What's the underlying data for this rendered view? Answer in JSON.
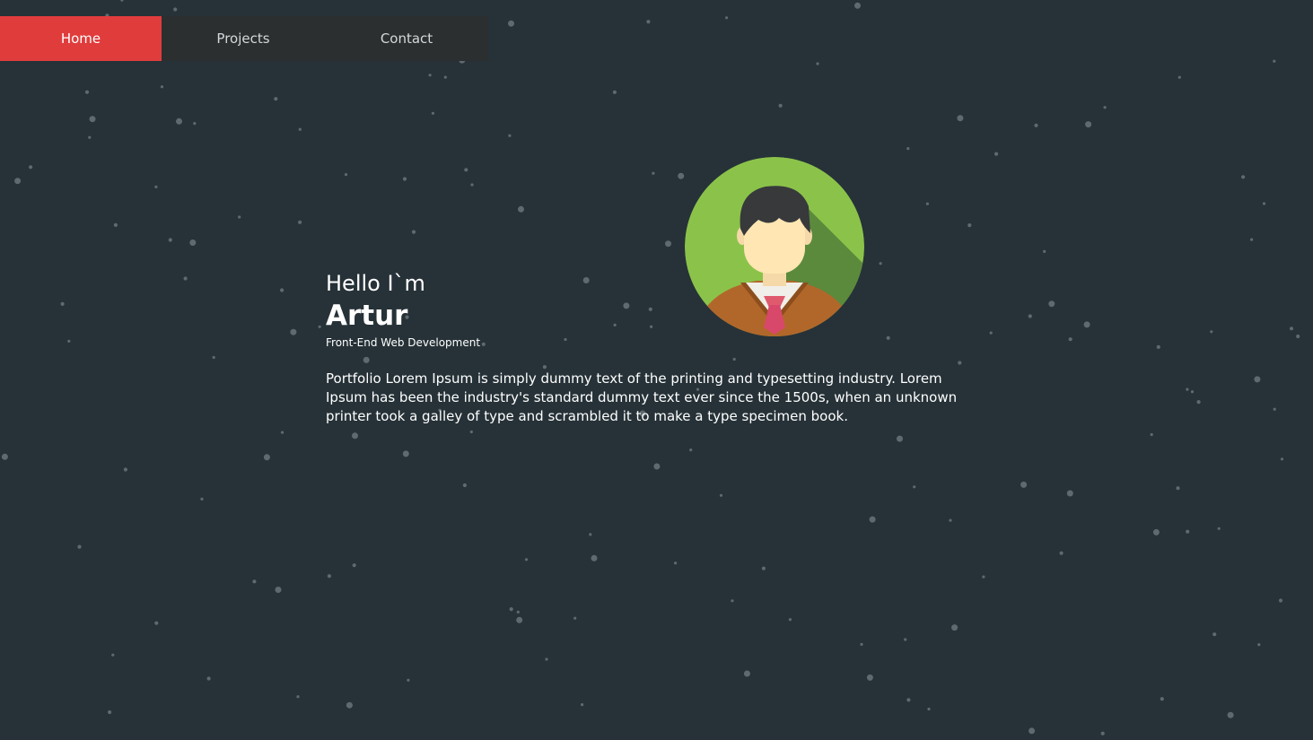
{
  "nav": {
    "items": [
      {
        "label": "Home",
        "active": true
      },
      {
        "label": "Projects",
        "active": false
      },
      {
        "label": "Contact",
        "active": false
      }
    ]
  },
  "hero": {
    "greeting": "Hello I`m",
    "name": "Artur",
    "role": "Front-End Web Development",
    "bio": "Portfolio Lorem Ipsum is simply dummy text of the printing and typesetting industry. Lorem Ipsum has been the industry's standard dummy text ever since the 1500s, when an unknown printer took a galley of type and scrambled it to make a type specimen book."
  },
  "avatar": {
    "icon": "user-avatar-icon"
  },
  "colors": {
    "background": "#263238",
    "accent": "#e03c3c",
    "nav_bg": "#2c2f30",
    "star": "#5f6a70",
    "avatar_green": "#8bc34a",
    "avatar_shadow": "#5b8a3c"
  }
}
